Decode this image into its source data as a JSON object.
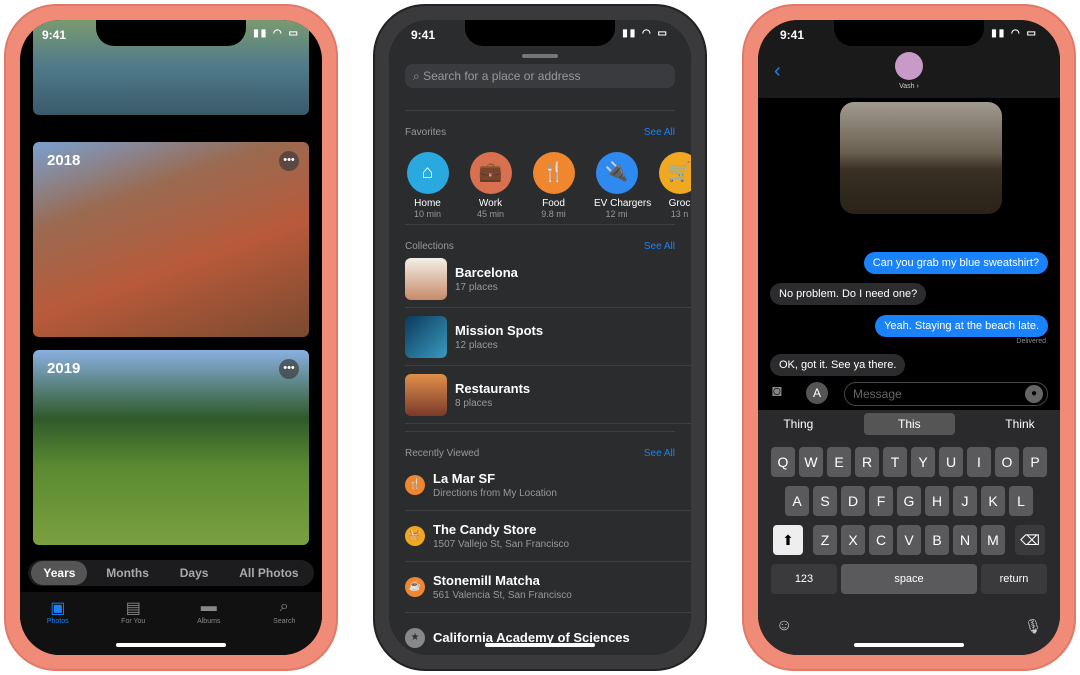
{
  "status_time": "9:41",
  "photos": {
    "years": [
      "2018",
      "2019"
    ],
    "segments": [
      "Years",
      "Months",
      "Days",
      "All Photos"
    ],
    "selected_segment": "Years",
    "tabs": [
      {
        "label": "Photos",
        "icon": "photos-icon"
      },
      {
        "label": "For You",
        "icon": "for-you-icon"
      },
      {
        "label": "Albums",
        "icon": "albums-icon"
      },
      {
        "label": "Search",
        "icon": "search-icon"
      }
    ],
    "active_tab": "Photos"
  },
  "maps": {
    "search_placeholder": "Search for a place or address",
    "favorites_label": "Favorites",
    "collections_label": "Collections",
    "recent_label": "Recently Viewed",
    "see_all": "See All",
    "favorites": [
      {
        "name": "Home",
        "sub": "10 min",
        "color": "#2aa9e0",
        "icon": "⌂"
      },
      {
        "name": "Work",
        "sub": "45 min",
        "color": "#d9704f",
        "icon": "💼"
      },
      {
        "name": "Food",
        "sub": "9.8 mi",
        "color": "#f0862e",
        "icon": "🍴"
      },
      {
        "name": "EV Chargers",
        "sub": "12 mi",
        "color": "#2f8af0",
        "icon": "🔌"
      },
      {
        "name": "Groc",
        "sub": "13 n",
        "color": "#f0a820",
        "icon": "🛒"
      }
    ],
    "collections": [
      {
        "name": "Barcelona",
        "sub": "17 places"
      },
      {
        "name": "Mission Spots",
        "sub": "12 places"
      },
      {
        "name": "Restaurants",
        "sub": "8 places"
      }
    ],
    "recent": [
      {
        "name": "La Mar SF",
        "sub": "Directions from My Location",
        "color": "#f0862e"
      },
      {
        "name": "The Candy Store",
        "sub": "1507 Vallejo St, San Francisco",
        "color": "#f0a820"
      },
      {
        "name": "Stonemill Matcha",
        "sub": "561 Valencia St, San Francisco",
        "color": "#f0862e"
      },
      {
        "name": "California Academy of Sciences",
        "sub": "",
        "color": "#888"
      }
    ]
  },
  "messages": {
    "contact": "Vash ›",
    "bubbles": [
      {
        "text": "Can you grab my blue sweatshirt?",
        "dir": "out"
      },
      {
        "text": "No problem. Do I need one?",
        "dir": "in"
      },
      {
        "text": "Yeah. Staying at the beach late.",
        "dir": "out"
      },
      {
        "text": "OK, got it. See ya there.",
        "dir": "in"
      }
    ],
    "delivered": "Delivered",
    "placeholder": "Message",
    "predictions": [
      "Thing",
      "This",
      "Think"
    ],
    "rows": [
      [
        "Q",
        "W",
        "E",
        "R",
        "T",
        "Y",
        "U",
        "I",
        "O",
        "P"
      ],
      [
        "A",
        "S",
        "D",
        "F",
        "G",
        "H",
        "J",
        "K",
        "L"
      ],
      [
        "Z",
        "X",
        "C",
        "V",
        "B",
        "N",
        "M"
      ]
    ],
    "num_key": "123",
    "space_key": "space",
    "return_key": "return"
  }
}
